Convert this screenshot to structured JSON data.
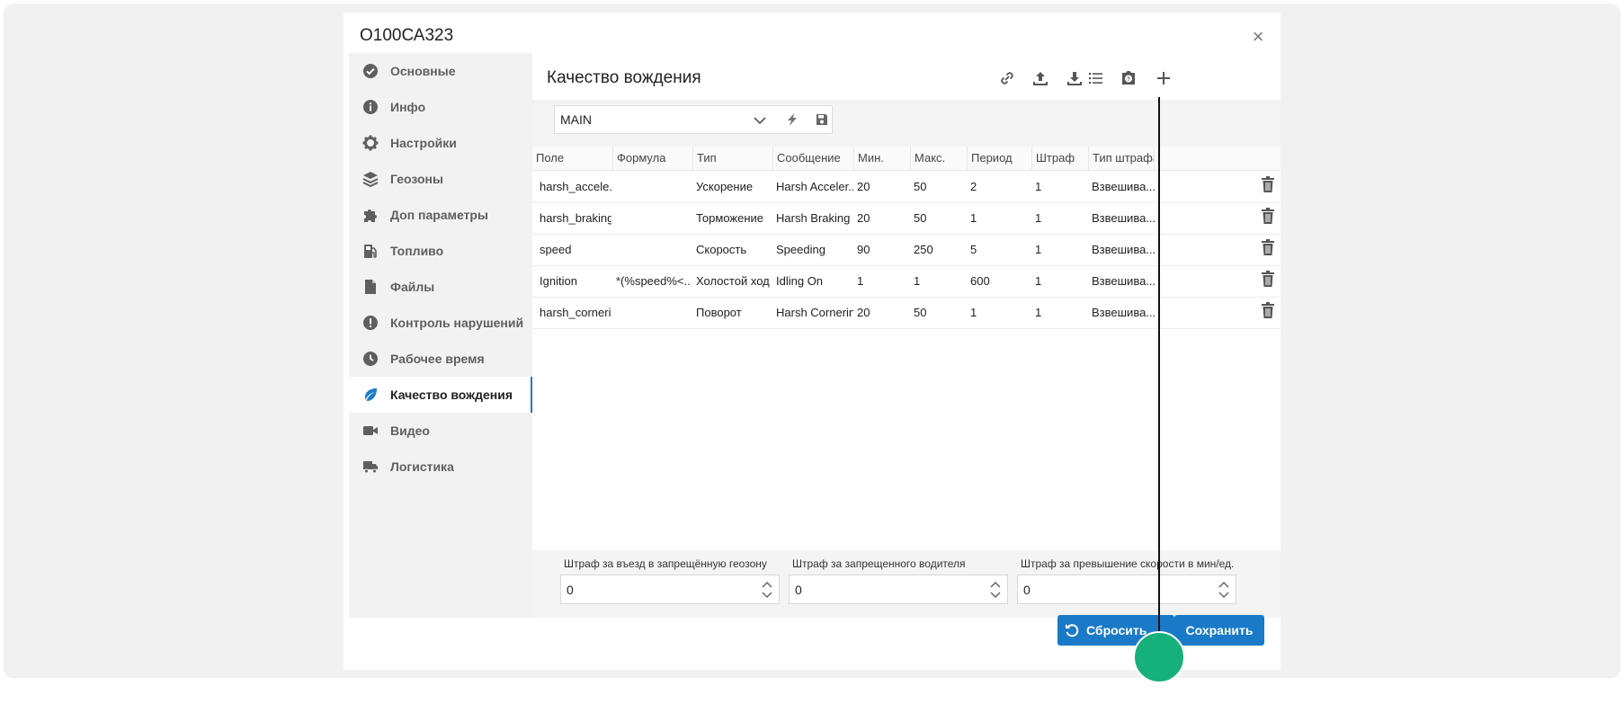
{
  "dialog": {
    "title": "О100СА323",
    "close_glyph": "×"
  },
  "sidebar": {
    "items": [
      {
        "label": "Основные",
        "icon": "check-circle-icon"
      },
      {
        "label": "Инфо",
        "icon": "info-icon"
      },
      {
        "label": "Настройки",
        "icon": "gear-icon"
      },
      {
        "label": "Геозоны",
        "icon": "layers-icon"
      },
      {
        "label": "Доп параметры",
        "icon": "puzzle-icon"
      },
      {
        "label": "Топливо",
        "icon": "fuel-pump-icon"
      },
      {
        "label": "Файлы",
        "icon": "file-icon"
      },
      {
        "label": "Контроль нарушений",
        "icon": "exclamation-circle-icon"
      },
      {
        "label": "Рабочее время",
        "icon": "clock-icon"
      },
      {
        "label": "Качество вождения",
        "icon": "leaf-icon",
        "active": true
      },
      {
        "label": "Видео",
        "icon": "video-camera-icon"
      },
      {
        "label": "Логистика",
        "icon": "truck-icon"
      }
    ]
  },
  "main": {
    "title": "Качество вождения",
    "toolbar": [
      "link-icon",
      "upload-icon",
      "download-icon",
      "list-icon",
      "help-box-icon",
      "plus-icon"
    ],
    "profile": {
      "value": "MAIN"
    },
    "columns": [
      "Поле",
      "Формула",
      "Тип",
      "Сообщение",
      "Мин.",
      "Макс.",
      "Период",
      "Штраф",
      "Тип штрафа"
    ],
    "rows": [
      {
        "field": "harsh_accele...",
        "formula": "",
        "type": "Ускорение",
        "message": "Harsh Acceler...",
        "min": "20",
        "max": "50",
        "period": "2",
        "penalty": "1",
        "penalty_type": "Взвешива..."
      },
      {
        "field": "harsh_braking",
        "formula": "",
        "type": "Торможение",
        "message": "Harsh Braking",
        "min": "20",
        "max": "50",
        "period": "1",
        "penalty": "1",
        "penalty_type": "Взвешива..."
      },
      {
        "field": "speed",
        "formula": "",
        "type": "Скорость",
        "message": "Speeding",
        "min": "90",
        "max": "250",
        "period": "5",
        "penalty": "1",
        "penalty_type": "Взвешива..."
      },
      {
        "field": "Ignition",
        "formula": "*(%speed%<...",
        "type": "Холостой ход",
        "message": "Idling On",
        "min": "1",
        "max": "1",
        "period": "600",
        "penalty": "1",
        "penalty_type": "Взвешива..."
      },
      {
        "field": "harsh_corneri...",
        "formula": "",
        "type": "Поворот",
        "message": "Harsh Cornering",
        "min": "20",
        "max": "50",
        "period": "1",
        "penalty": "1",
        "penalty_type": "Взвешива..."
      }
    ],
    "penalties": [
      {
        "label": "Штраф за въезд в запрещённую геозону",
        "value": "0"
      },
      {
        "label": "Штраф за запрещенного водителя",
        "value": "0"
      },
      {
        "label": "Штраф за превышение скорости в мин/ед.",
        "value": "0"
      }
    ]
  },
  "buttons": {
    "reset_label": "Сбросить",
    "save_label": "Сохранить"
  },
  "colors": {
    "accent": "#1a7ac7",
    "pointer_dot": "#16b07c"
  }
}
